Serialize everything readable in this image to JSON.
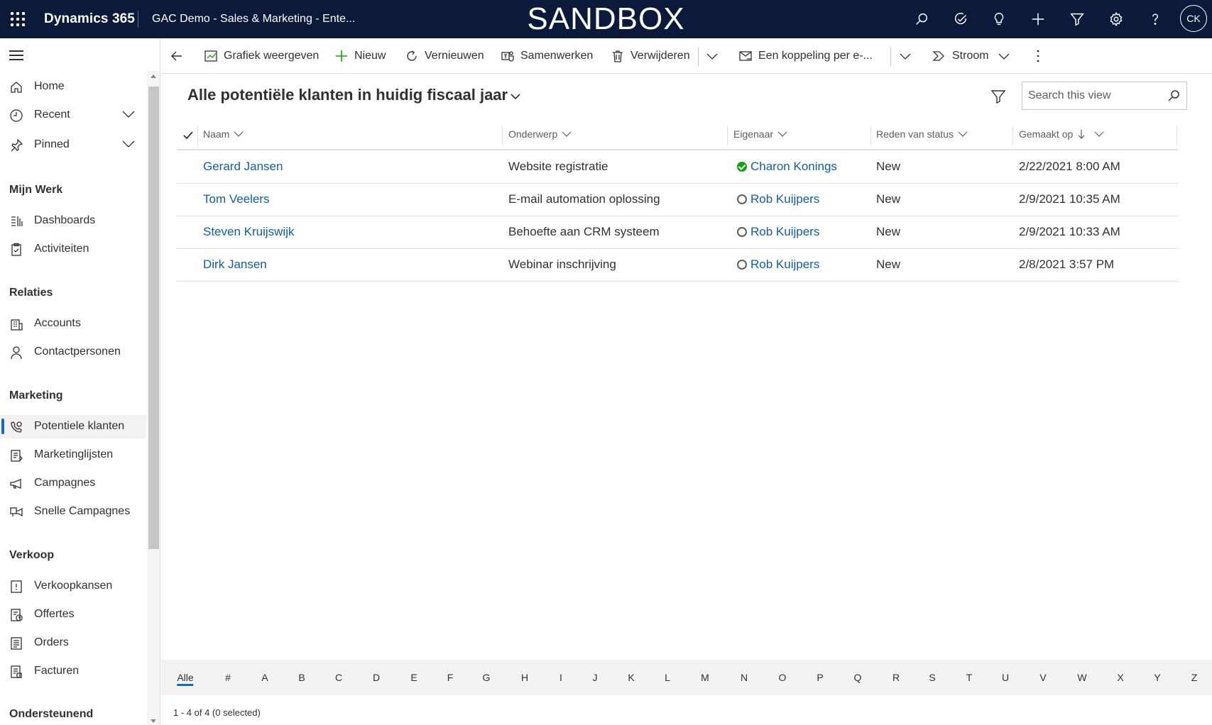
{
  "topbar": {
    "brand": "Dynamics 365",
    "app_name": "GAC Demo - Sales & Marketing - Ente...",
    "environment_banner": "SANDBOX",
    "icons": [
      "search-icon",
      "task-check-icon",
      "lightbulb-icon",
      "plus-icon",
      "filter-icon",
      "settings-gear-icon",
      "help-icon"
    ],
    "avatar_initials": "CK",
    "background_color": "#0b1a3a"
  },
  "sidebar": {
    "top_items": [
      {
        "label": "Home",
        "icon": "home-icon"
      },
      {
        "label": "Recent",
        "icon": "clock-icon",
        "expandable": true
      },
      {
        "label": "Pinned",
        "icon": "pin-icon",
        "expandable": true
      }
    ],
    "groups": [
      {
        "title": "Mijn Werk",
        "items": [
          {
            "label": "Dashboards",
            "icon": "dashboard-icon"
          },
          {
            "label": "Activiteiten",
            "icon": "clipboard-icon"
          }
        ]
      },
      {
        "title": "Relaties",
        "items": [
          {
            "label": "Accounts",
            "icon": "building-icon"
          },
          {
            "label": "Contactpersonen",
            "icon": "person-icon"
          }
        ]
      },
      {
        "title": "Marketing",
        "items": [
          {
            "label": "Potentiele klanten",
            "icon": "phone-lead-icon",
            "active": true
          },
          {
            "label": "Marketinglijsten",
            "icon": "list-icon"
          },
          {
            "label": "Campagnes",
            "icon": "megaphone-icon"
          },
          {
            "label": "Snelle Campagnes",
            "icon": "quick-campaign-icon"
          }
        ]
      },
      {
        "title": "Verkoop",
        "items": [
          {
            "label": "Verkoopkansen",
            "icon": "opportunity-icon"
          },
          {
            "label": "Offertes",
            "icon": "quote-icon"
          },
          {
            "label": "Orders",
            "icon": "order-icon"
          },
          {
            "label": "Facturen",
            "icon": "invoice-icon"
          }
        ]
      },
      {
        "title": "Ondersteunend",
        "items": []
      }
    ]
  },
  "commandbar": {
    "buttons": [
      {
        "label": "Grafiek weergeven",
        "icon": "chart-icon"
      },
      {
        "label": "Nieuw",
        "icon": "plus-icon"
      },
      {
        "label": "Vernieuwen",
        "icon": "refresh-icon"
      },
      {
        "label": "Samenwerken",
        "icon": "teams-icon"
      },
      {
        "label": "Verwijderen",
        "icon": "trash-icon"
      },
      {
        "label": "Een koppeling per e-...",
        "icon": "email-link-icon"
      },
      {
        "label": "Stroom",
        "icon": "flow-icon"
      }
    ]
  },
  "view": {
    "title": "Alle potentiële klanten in huidig fiscaal jaar",
    "search_placeholder": "Search this view"
  },
  "grid": {
    "columns": [
      "Naam",
      "Onderwerp",
      "Eigenaar",
      "Reden van status",
      "Gemaakt op"
    ],
    "sorted_column": "Gemaakt op",
    "rows": [
      {
        "naam": "Gerard Jansen",
        "onderwerp": "Website registratie",
        "eigenaar": "Charon Konings",
        "eigenaar_status": "online",
        "reden": "New",
        "gemaakt": "2/22/2021 8:00 AM"
      },
      {
        "naam": "Tom Veelers",
        "onderwerp": "E-mail automation oplossing",
        "eigenaar": "Rob Kuijpers",
        "eigenaar_status": "offline",
        "reden": "New",
        "gemaakt": "2/9/2021 10:35 AM"
      },
      {
        "naam": "Steven Kruijswijk",
        "onderwerp": "Behoefte aan CRM systeem",
        "eigenaar": "Rob Kuijpers",
        "eigenaar_status": "offline",
        "reden": "New",
        "gemaakt": "2/9/2021 10:33 AM"
      },
      {
        "naam": "Dirk Jansen",
        "onderwerp": "Webinar inschrijving",
        "eigenaar": "Rob Kuijpers",
        "eigenaar_status": "offline",
        "reden": "New",
        "gemaakt": "2/8/2021 3:57 PM"
      }
    ]
  },
  "footer": {
    "alpha_index": [
      "Alle",
      "#",
      "A",
      "B",
      "C",
      "D",
      "E",
      "F",
      "G",
      "H",
      "I",
      "J",
      "K",
      "L",
      "M",
      "N",
      "O",
      "P",
      "Q",
      "R",
      "S",
      "T",
      "U",
      "V",
      "W",
      "X",
      "Y",
      "Z"
    ],
    "active_letter": "Alle",
    "status": "1 - 4 of 4 (0 selected)"
  },
  "colors": {
    "accent": "#0f6cbd",
    "link": "#115ea3",
    "online": "#13a10e"
  }
}
